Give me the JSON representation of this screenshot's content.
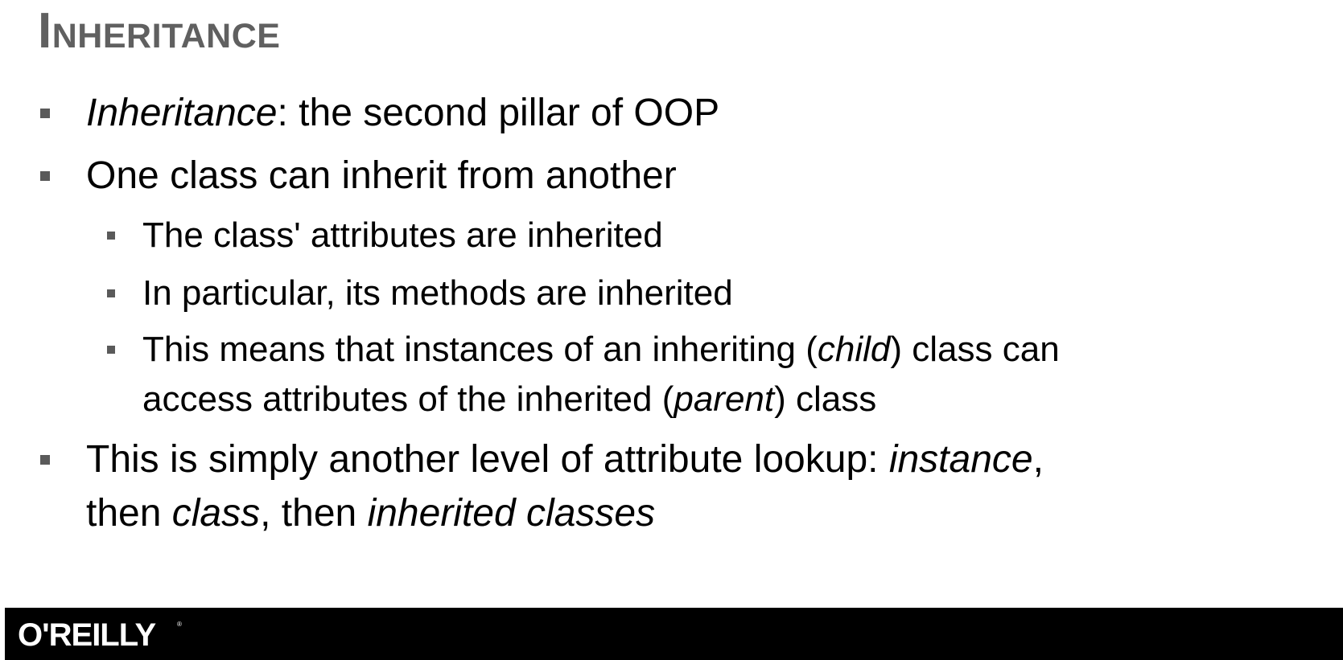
{
  "slide": {
    "title": "Inheritance",
    "bullets": [
      {
        "parts": [
          {
            "text": "Inheritance",
            "italic": true
          },
          {
            "text": ": the second pillar of OOP",
            "italic": false
          }
        ]
      },
      {
        "parts": [
          {
            "text": "One class can inherit from another",
            "italic": false
          }
        ]
      },
      {
        "parts": [
          {
            "text": "The class' attributes are inherited",
            "italic": false
          }
        ]
      },
      {
        "parts": [
          {
            "text": "In particular, its methods are inherited",
            "italic": false
          }
        ]
      },
      {
        "line1": [
          {
            "text": "This means that instances of an inheriting (",
            "italic": false
          },
          {
            "text": "child",
            "italic": true
          },
          {
            "text": ") class can",
            "italic": false
          }
        ],
        "line2": [
          {
            "text": "access attributes of the inherited (",
            "italic": false
          },
          {
            "text": "parent",
            "italic": true
          },
          {
            "text": ") class",
            "italic": false
          }
        ]
      },
      {
        "line1": [
          {
            "text": "This is simply another level of attribute lookup:  ",
            "italic": false
          },
          {
            "text": "instance",
            "italic": true
          },
          {
            "text": ",",
            "italic": false
          }
        ],
        "line2": [
          {
            "text": "then ",
            "italic": false
          },
          {
            "text": "class",
            "italic": true
          },
          {
            "text": ", then ",
            "italic": false
          },
          {
            "text": "inherited classes",
            "italic": true
          }
        ]
      }
    ]
  },
  "footer": {
    "logo_text": "O'REILLY",
    "registered_mark": "®"
  },
  "colors": {
    "title": "#606060",
    "bullet_marker": "#5a5a5a",
    "footer_bg": "#000000",
    "logo": "#ffffff"
  }
}
